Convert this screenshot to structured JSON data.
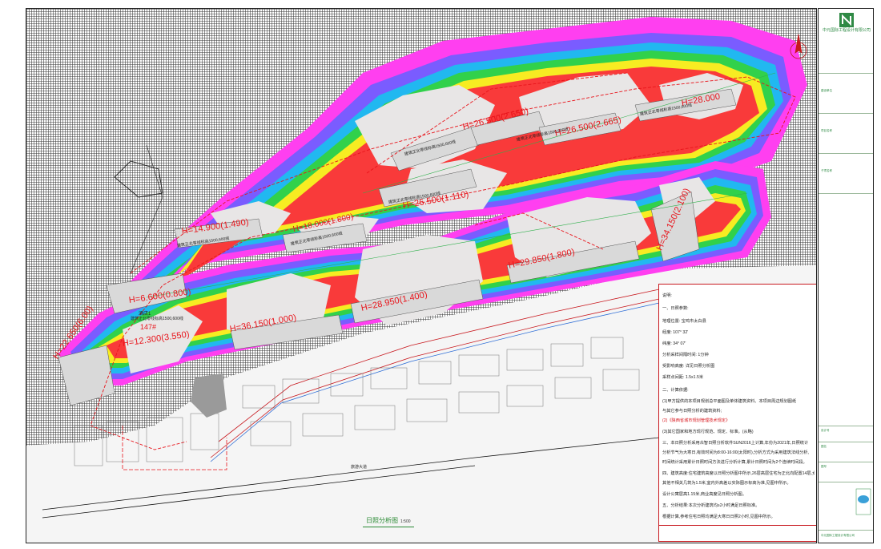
{
  "drawing": {
    "caption": "日照分析图",
    "scale": "1:500",
    "heights": [
      {
        "text": "H=14.900(1.490)"
      },
      {
        "text": "H=18.000(1.800)"
      },
      {
        "text": "H=26.500(2.650)"
      },
      {
        "text": "H=26.500(2.665)"
      },
      {
        "text": "H=26.500(1.110)"
      },
      {
        "text": "H=28.000"
      },
      {
        "text": "H=6.600(0.800)"
      },
      {
        "text": "H=12.300(3.550)"
      },
      {
        "text": "H=22.650(6.00)"
      },
      {
        "text": "H=36.150(1.000)"
      },
      {
        "text": "H=28.950(1.400)"
      },
      {
        "text": "H=29.850(1.800)"
      },
      {
        "text": "H=34.150(2.100)"
      }
    ],
    "building_labels": [
      "建筑正北零线标高1500,600线",
      "建筑正北零线标高1500,600线",
      "建筑正北零线标高1500,600线",
      "建筑正北零线标高1500,600线",
      "建筑正北零线标高1500,600线",
      "建筑正北零线标高1500,600线"
    ],
    "site_labels": {
      "school": "酒店1",
      "school_sub": "建筑正北零线标高1500,600线",
      "number": "147#",
      "road": "旅游大道"
    }
  },
  "notes": {
    "lines": [
      {
        "text": "说明:",
        "red": false
      },
      {
        "text": "一、日照参数:",
        "red": false
      },
      {
        "text": "地理位置:  宝鸡市太白县",
        "red": false
      },
      {
        "text": "经度:  107° 32'",
        "red": false
      },
      {
        "text": "纬度:  34° 07'",
        "red": false
      },
      {
        "text": "分析采样间隔时间:  1分钟",
        "red": false
      },
      {
        "text": "受影响高度:  详见日照分析图",
        "red": false
      },
      {
        "text": "采样点间距:  1.5x1.5米",
        "red": false
      },
      {
        "text": "二、计算依据:",
        "red": false
      },
      {
        "text": "(1)甲方提供的本项目规划总平面图及单体建筑资料、本项目周边规划图纸",
        "red": false
      },
      {
        "text": "与其它参与日照分析的建筑资料;",
        "red": false
      },
      {
        "text": "(2)《陕西省城市规划管理技术规定》",
        "red": true
      },
      {
        "text": "(3)其它国家和地方现行规范、规定、标准。(从略)",
        "red": false
      },
      {
        "text": "三、本日照分析采用众智日照分析软件SUN2016上计算,年份为2021年,日照统计",
        "red": false
      },
      {
        "text": "分析节气为大寒日,有效时间为8:00-16:00(太阳时),分析方式为采用建筑法线分析,",
        "red": false
      },
      {
        "text": "时间统计采用累计日照时间方法进行分析计算,累计日照时间为2个连续时间段。",
        "red": false
      },
      {
        "text": "四、建筑高度:住宅建筑高度以日照分析图中所示,26层高层住宅为正北向配置14层,女儿墙以上高度另计,",
        "red": false
      },
      {
        "text": "其他不相关几筑为1.5米,室内外高差以实际图示标高为准,见图中所示。",
        "red": false
      },
      {
        "text": "设计公寓层高1.15米,商业高度见日照分析图。",
        "red": false
      },
      {
        "text": "五、分析结果:本次分析建筑均≥2小时满足日照标准。",
        "red": false
      },
      {
        "text": "根据计算,参考住宅日照均满足大寒日日照2小时,见图中所示。",
        "red": false
      }
    ]
  },
  "titleblock": {
    "company": "中元国际工程设计有限公司",
    "rows": [
      {
        "label": "建设单位"
      },
      {
        "label": "项目名称"
      },
      {
        "label": "子项名称"
      },
      {
        "label": "设计号"
      },
      {
        "label": "图名"
      },
      {
        "label": "图号"
      }
    ],
    "footer": "中元国际工程设计有限公司"
  }
}
